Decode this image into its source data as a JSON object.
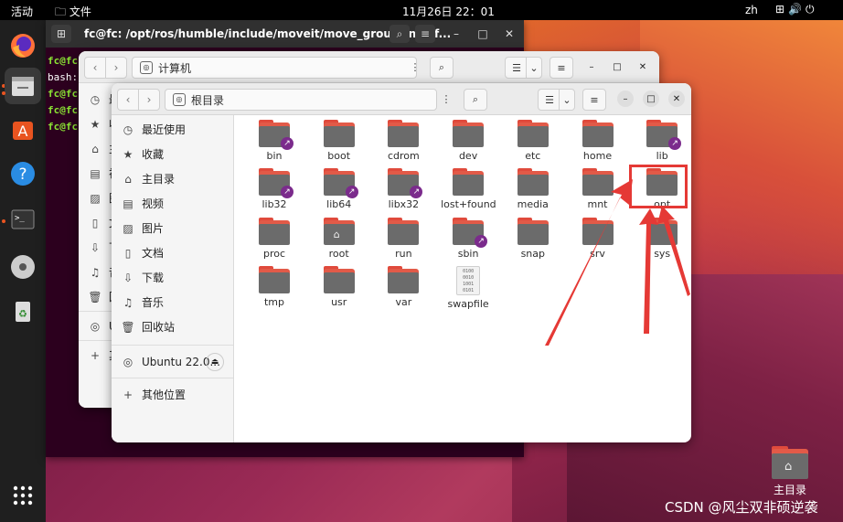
{
  "topbar": {
    "activities": "活动",
    "app_menu": "文件",
    "clock": "11月26日 22：01",
    "lang": "zh"
  },
  "terminal": {
    "title": "fc@fc: /opt/ros/humble/include/moveit/move_group_interf...",
    "lines": [
      {
        "prompt": "fc@fc",
        "rest": ""
      },
      {
        "prompt": "",
        "rest": "bash:"
      },
      {
        "prompt": "fc@fc",
        "rest": ""
      },
      {
        "prompt": "fc@fc",
        "rest": ""
      },
      {
        "prompt": "fc@fc",
        "rest": ""
      }
    ]
  },
  "back_window": {
    "path": "计算机",
    "sidebar": [
      {
        "icon": "clock-icon",
        "label": "最"
      },
      {
        "icon": "star-icon",
        "label": "收"
      },
      {
        "icon": "home-icon",
        "label": "主"
      },
      {
        "icon": "video-icon",
        "label": "视"
      },
      {
        "icon": "image-icon",
        "label": "图"
      },
      {
        "icon": "document-icon",
        "label": "文"
      },
      {
        "icon": "download-icon",
        "label": "下"
      },
      {
        "icon": "music-icon",
        "label": "音"
      },
      {
        "icon": "trash-icon",
        "label": "回"
      },
      {
        "icon": "disc-icon",
        "label": "Ub"
      },
      {
        "icon": "plus-icon",
        "label": "其"
      }
    ]
  },
  "front_window": {
    "path": "根目录",
    "sidebar": [
      {
        "icon": "clock-icon",
        "label": "最近使用"
      },
      {
        "icon": "star-icon",
        "label": "收藏"
      },
      {
        "icon": "home-icon",
        "label": "主目录"
      },
      {
        "icon": "video-icon",
        "label": "视频"
      },
      {
        "icon": "image-icon",
        "label": "图片"
      },
      {
        "icon": "document-icon",
        "label": "文档"
      },
      {
        "icon": "download-icon",
        "label": "下载"
      },
      {
        "icon": "music-icon",
        "label": "音乐"
      },
      {
        "icon": "trash-icon",
        "label": "回收站"
      }
    ],
    "device": {
      "label": "Ubuntu 22.0..."
    },
    "other": {
      "label": "其他位置"
    },
    "files": [
      {
        "name": "bin",
        "type": "link"
      },
      {
        "name": "boot",
        "type": "folder"
      },
      {
        "name": "cdrom",
        "type": "folder"
      },
      {
        "name": "dev",
        "type": "folder"
      },
      {
        "name": "etc",
        "type": "folder"
      },
      {
        "name": "home",
        "type": "folder"
      },
      {
        "name": "lib",
        "type": "link"
      },
      {
        "name": "lib32",
        "type": "link"
      },
      {
        "name": "lib64",
        "type": "link"
      },
      {
        "name": "libx32",
        "type": "link"
      },
      {
        "name": "lost+found",
        "type": "folder"
      },
      {
        "name": "media",
        "type": "folder"
      },
      {
        "name": "mnt",
        "type": "folder"
      },
      {
        "name": "opt",
        "type": "folder"
      },
      {
        "name": "proc",
        "type": "folder"
      },
      {
        "name": "root",
        "type": "home"
      },
      {
        "name": "run",
        "type": "folder"
      },
      {
        "name": "sbin",
        "type": "link"
      },
      {
        "name": "snap",
        "type": "folder"
      },
      {
        "name": "srv",
        "type": "folder"
      },
      {
        "name": "sys",
        "type": "folder"
      },
      {
        "name": "tmp",
        "type": "folder"
      },
      {
        "name": "usr",
        "type": "folder"
      },
      {
        "name": "var",
        "type": "folder"
      },
      {
        "name": "swapfile",
        "type": "binary"
      }
    ]
  },
  "desktop": {
    "home_label": "主目录",
    "watermark": "CSDN @风尘双非硕逆袭"
  },
  "binary_preview": "0100 0010 1001 0101"
}
